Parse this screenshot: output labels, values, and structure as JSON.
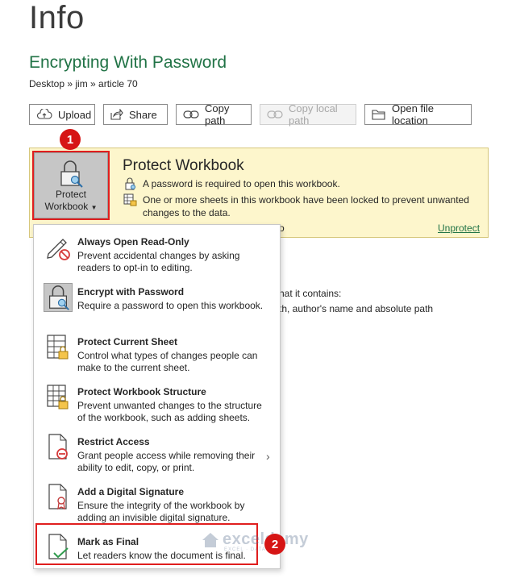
{
  "page": {
    "title": "Info"
  },
  "document": {
    "title": "Encrypting With Password",
    "breadcrumb": "Desktop » jim » article 70"
  },
  "toolbar": {
    "upload": "Upload",
    "share": "Share",
    "copy_path": "Copy path",
    "copy_local_path": "Copy local path",
    "open_file_location": "Open file location"
  },
  "protect": {
    "button_line1": "Protect",
    "button_line2": "Workbook",
    "heading": "Protect Workbook",
    "line1": "A password is required to open this workbook.",
    "line2": "One or more sheets in this workbook have been locked to prevent unwanted changes to the data.",
    "tail": "o",
    "unprotect": "Unprotect"
  },
  "background": {
    "line1": "hat it contains:",
    "line2": "th, author's name and absolute path"
  },
  "menu": {
    "items": [
      {
        "title": "Always Open Read-Only",
        "desc": "Prevent accidental changes by asking readers to opt-in to editing.",
        "icon": "pencil-prohibited-icon"
      },
      {
        "title": "Encrypt with Password",
        "desc": "Require a password to open this workbook.",
        "icon": "lock-key-icon"
      },
      {
        "title": "Protect Current Sheet",
        "desc": "Control what types of changes people can make to the current sheet.",
        "icon": "sheet-lock-icon"
      },
      {
        "title": "Protect Workbook Structure",
        "desc": "Prevent unwanted changes to the structure of the workbook, such as adding sheets.",
        "icon": "workbook-structure-lock-icon"
      },
      {
        "title": "Restrict Access",
        "desc": "Grant people access while removing their ability to edit, copy, or print.",
        "icon": "document-restricted-icon"
      },
      {
        "title": "Add a Digital Signature",
        "desc": "Ensure the integrity of the workbook by adding an invisible digital signature.",
        "icon": "document-ribbon-icon"
      },
      {
        "title": "Mark as Final",
        "desc": "Let readers know the document is final.",
        "icon": "document-check-icon"
      }
    ]
  },
  "badges": {
    "step1": "1",
    "step2": "2"
  },
  "watermark": {
    "name": "exceldemy",
    "sub": "EXCEL · DATA · BI"
  },
  "colors": {
    "accent": "#217346",
    "panel_bg": "#fdf6cc",
    "highlight": "#e01e1e"
  }
}
